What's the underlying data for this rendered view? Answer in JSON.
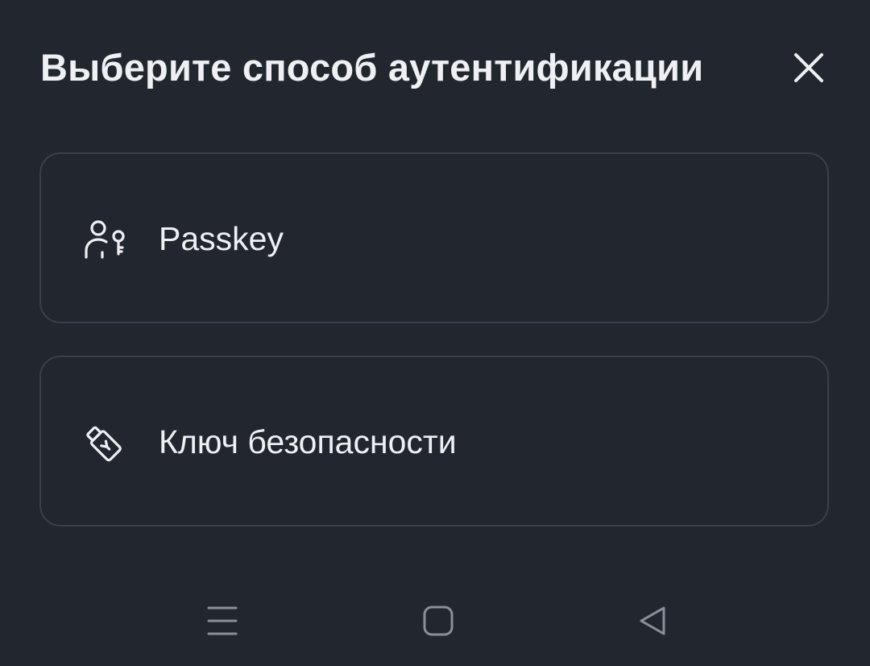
{
  "dialog": {
    "title": "Выберите способ аутентификации",
    "close_icon": "close-icon"
  },
  "options": [
    {
      "label": "Passkey",
      "icon": "passkey-icon"
    },
    {
      "label": "Ключ безопасности",
      "icon": "security-key-icon"
    }
  ],
  "navigation_bar": {
    "buttons": [
      "menu-icon",
      "home-icon",
      "back-icon"
    ]
  },
  "colors": {
    "background": "#22262f",
    "border": "#3a3f4b",
    "text": "#eef0f3",
    "nav_icon": "#8a8f9a"
  }
}
